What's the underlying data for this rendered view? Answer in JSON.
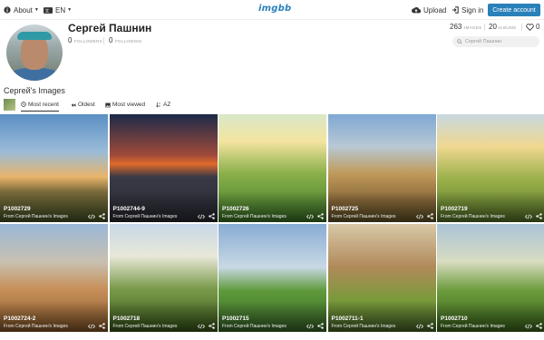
{
  "topbar": {
    "about": "About",
    "lang": "EN",
    "logo": "imgbb",
    "upload": "Upload",
    "signin": "Sign in",
    "create": "Create account"
  },
  "profile": {
    "name": "Сергей Пашнин",
    "followers_count": "0",
    "followers_label": "FOLLOWERS",
    "following_count": "0",
    "following_label": "FOLLOWING",
    "images_count": "263",
    "images_label": "IMAGES",
    "albums_count": "20",
    "albums_label": "ALBUMS",
    "likes_count": "0",
    "search_placeholder": "Сергей Пашнин"
  },
  "section_title": "Сергей's Images",
  "sort": {
    "recent": "Most recent",
    "oldest": "Oldest",
    "viewed": "Most viewed",
    "az": "AZ"
  },
  "images": [
    {
      "title": "P1002729",
      "source": "From Сергей Пашнин's Images"
    },
    {
      "title": "P1002744-9",
      "source": "From Сергей Пашнин's Images"
    },
    {
      "title": "P1002726",
      "source": "From Сергей Пашнин's Images"
    },
    {
      "title": "P1002725",
      "source": "From Сергей Пашнин's Images"
    },
    {
      "title": "P1002719",
      "source": "From Сергей Пашнин's Images"
    },
    {
      "title": "P1002724-2",
      "source": "From Сергей Пашнин's Images"
    },
    {
      "title": "P1002718",
      "source": "From Сергей Пашнин's Images"
    },
    {
      "title": "P1002715",
      "source": "From Сергей Пашнин's Images"
    },
    {
      "title": "P1002711-1",
      "source": "From Сергей Пашнин's Images"
    },
    {
      "title": "P1002710",
      "source": "From Сергей Пашнин's Images"
    }
  ],
  "colors": {
    "accent": "#2a80b9"
  }
}
